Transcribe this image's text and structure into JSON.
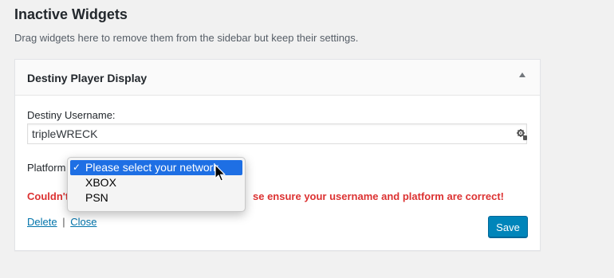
{
  "section": {
    "title": "Inactive Widgets",
    "description": "Drag widgets here to remove them from the sidebar but keep their settings."
  },
  "widget": {
    "title": "Destiny Player Display",
    "toggle_icon": "arrow-up-icon",
    "username_label": "Destiny Username:",
    "username_value": "tripleWRECK",
    "input_icon": "gear-icon",
    "platform_label": "Platform",
    "error_left": "Couldn't",
    "error_right": "se ensure your username and platform are correct!",
    "delete_label": "Delete",
    "separator": "|",
    "close_label": "Close",
    "save_label": "Save"
  },
  "dropdown": {
    "options": [
      {
        "label": "Please select your network",
        "selected": true,
        "check": "✓"
      },
      {
        "label": "XBOX",
        "selected": false
      },
      {
        "label": "PSN",
        "selected": false
      }
    ]
  },
  "colors": {
    "error": "#dc3232",
    "link": "#0073aa",
    "primary": "#0085ba",
    "selection": "#1e6fe4"
  }
}
